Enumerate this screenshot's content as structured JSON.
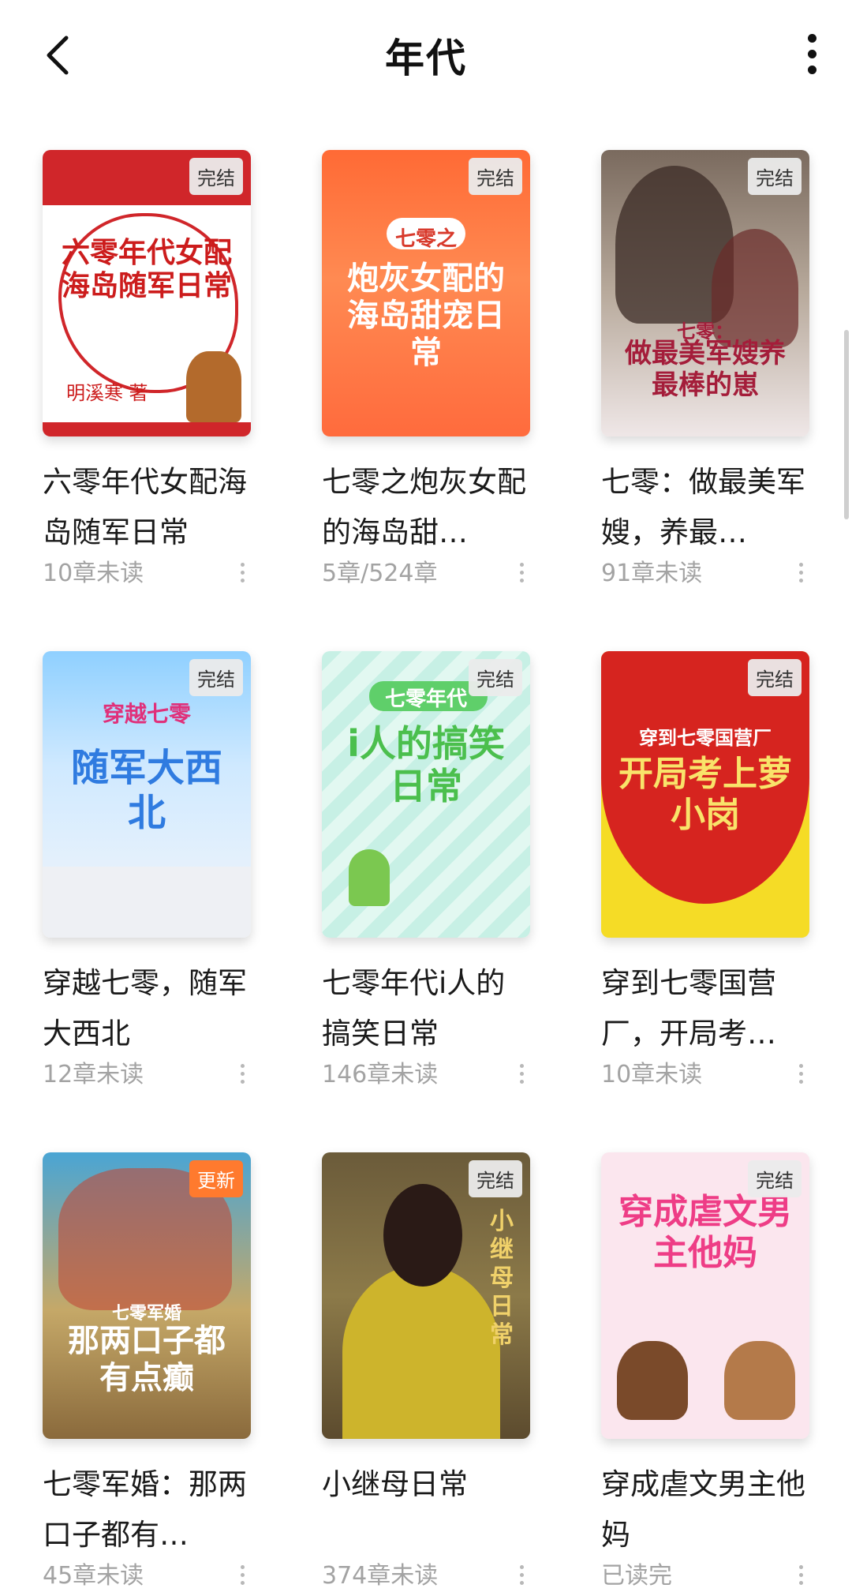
{
  "header": {
    "title": "年代"
  },
  "books": [
    {
      "cover_sub": "",
      "cover_title": "六零年代女配海岛随军日常",
      "cover_author": "明溪寒 著",
      "badge": "完结",
      "title": "六零年代女配海岛随军日常",
      "progress": "10章未读"
    },
    {
      "cover_sub": "七零之",
      "cover_title": "炮灰女配的海岛甜宠日常",
      "cover_author": "",
      "badge": "完结",
      "title": "七零之炮灰女配的海岛甜…",
      "progress": "5章/524章"
    },
    {
      "cover_sub": "七零：",
      "cover_title": "做最美军嫂养最棒的崽",
      "cover_author": "",
      "badge": "完结",
      "title": "七零：做最美军嫂，养最…",
      "progress": "91章未读"
    },
    {
      "cover_sub": "穿越七零",
      "cover_title": "随军大西北",
      "cover_author": "",
      "badge": "完结",
      "title": "穿越七零，随军大西北",
      "progress": "12章未读"
    },
    {
      "cover_sub": "七零年代",
      "cover_title": "i人的搞笑日常",
      "cover_author": "",
      "badge": "完结",
      "title": "七零年代i人的搞笑日常",
      "progress": "146章未读"
    },
    {
      "cover_sub": "穿到七零国营厂",
      "cover_title": "开局考上萝小岗",
      "cover_author": "",
      "badge": "完结",
      "title": "穿到七零国营厂，开局考…",
      "progress": "10章未读"
    },
    {
      "cover_sub": "七零军婚",
      "cover_title": "那两口子都有点癫",
      "cover_author": "",
      "badge": "更新",
      "title": "七零军婚：那两口子都有…",
      "progress": "45章未读"
    },
    {
      "cover_sub": "",
      "cover_title": "小继母日常",
      "cover_author": "",
      "badge": "完结",
      "title": "小继母日常",
      "progress": "374章未读"
    },
    {
      "cover_sub": "",
      "cover_title": "穿成虐文男主他妈",
      "cover_author": "",
      "badge": "完结",
      "title": "穿成虐文男主他妈",
      "progress": "已读完"
    }
  ]
}
